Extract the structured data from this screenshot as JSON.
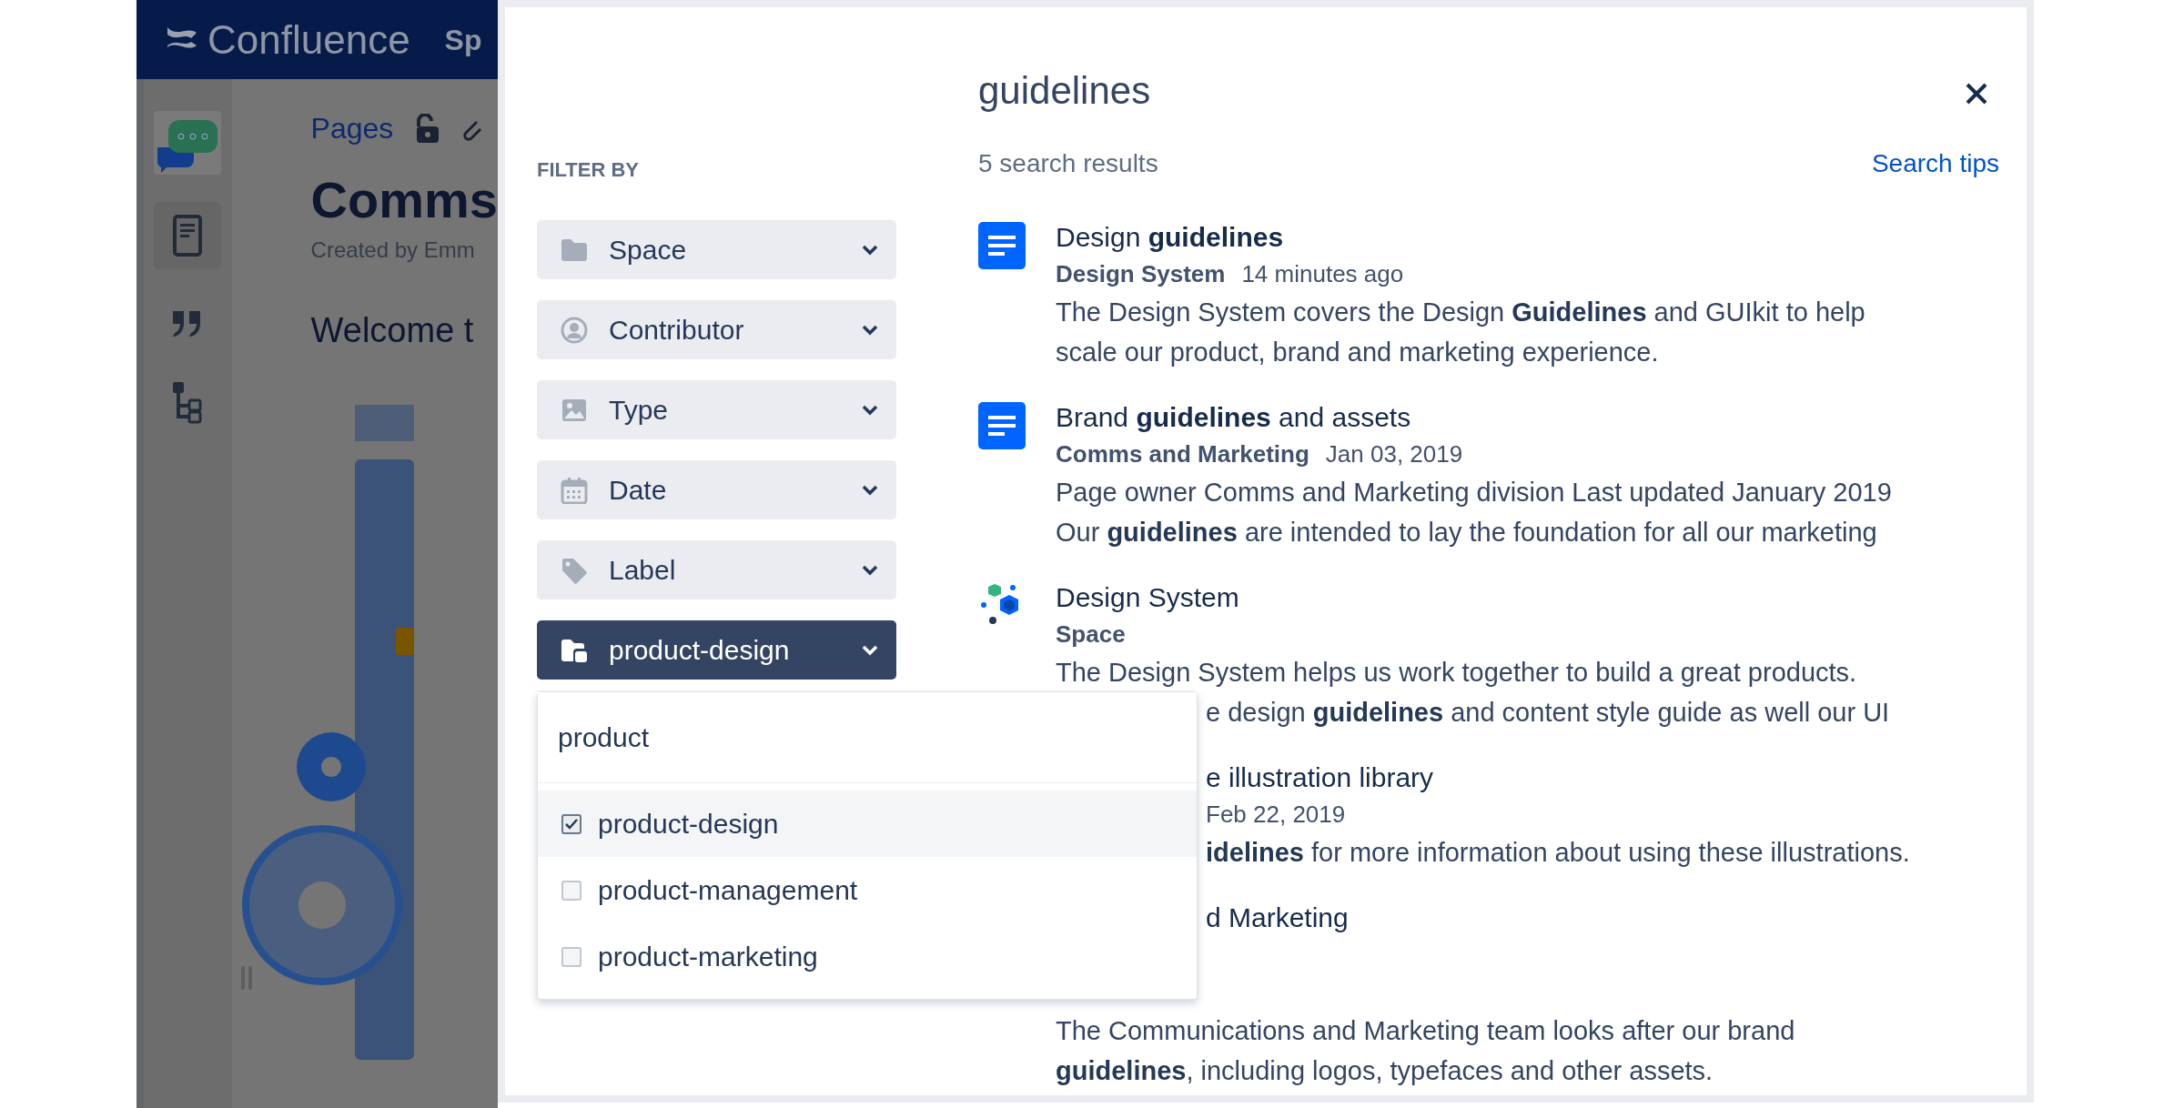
{
  "background_app": {
    "product_name": "Confluence",
    "nav_item": "Sp",
    "breadcrumb": "Pages",
    "page_title": "Comms",
    "byline": "Created by Emm",
    "heading": "Welcome t"
  },
  "search": {
    "query": "guidelines",
    "filter_heading": "FILTER BY",
    "result_count": "5 search results",
    "tips_link": "Search tips"
  },
  "filters": [
    {
      "label": "Space",
      "kind": "space",
      "selected": false
    },
    {
      "label": "Contributor",
      "kind": "contributor",
      "selected": false
    },
    {
      "label": "Type",
      "kind": "type",
      "selected": false
    },
    {
      "label": "Date",
      "kind": "date",
      "selected": false
    },
    {
      "label": "Label",
      "kind": "label",
      "selected": false
    },
    {
      "label": "product-design",
      "kind": "label_value",
      "selected": true
    }
  ],
  "label_dropdown": {
    "value": "product",
    "options": [
      {
        "label": "product-design",
        "checked": true
      },
      {
        "label": "product-management",
        "checked": false
      },
      {
        "label": "product-marketing",
        "checked": false
      }
    ]
  },
  "results": [
    {
      "kind": "page",
      "title": "Design **guidelines**",
      "space": "Design System",
      "time": "14 minutes ago",
      "snippet": [
        "The Design System covers the Design **Guidelines** and GUIkit to help",
        "scale our product, brand and marketing experience."
      ]
    },
    {
      "kind": "page",
      "title": "Brand **guidelines** and assets",
      "space": "Comms and Marketing",
      "time": "Jan 03, 2019",
      "snippet": [
        "Page owner Comms and Marketing division Last updated January 2019",
        "Our **guidelines** are intended to lay the foundation for all our marketing"
      ]
    },
    {
      "kind": "space",
      "title": "Design System",
      "space": "Space",
      "snippet": [
        "The Design System helps us work together to build a great products.",
        "e design **guidelines** and content style guide as well our UI"
      ]
    },
    {
      "kind": "covered",
      "title": "e illustration library",
      "time": "Feb 22, 2019",
      "snippet": [
        "**idelines** for more information about using these illustrations."
      ]
    },
    {
      "kind": "covered",
      "title": "d Marketing",
      "snippet": [
        "The Communications and Marketing team looks after our brand",
        "**guidelines**, including logos, typefaces and other assets."
      ]
    }
  ]
}
